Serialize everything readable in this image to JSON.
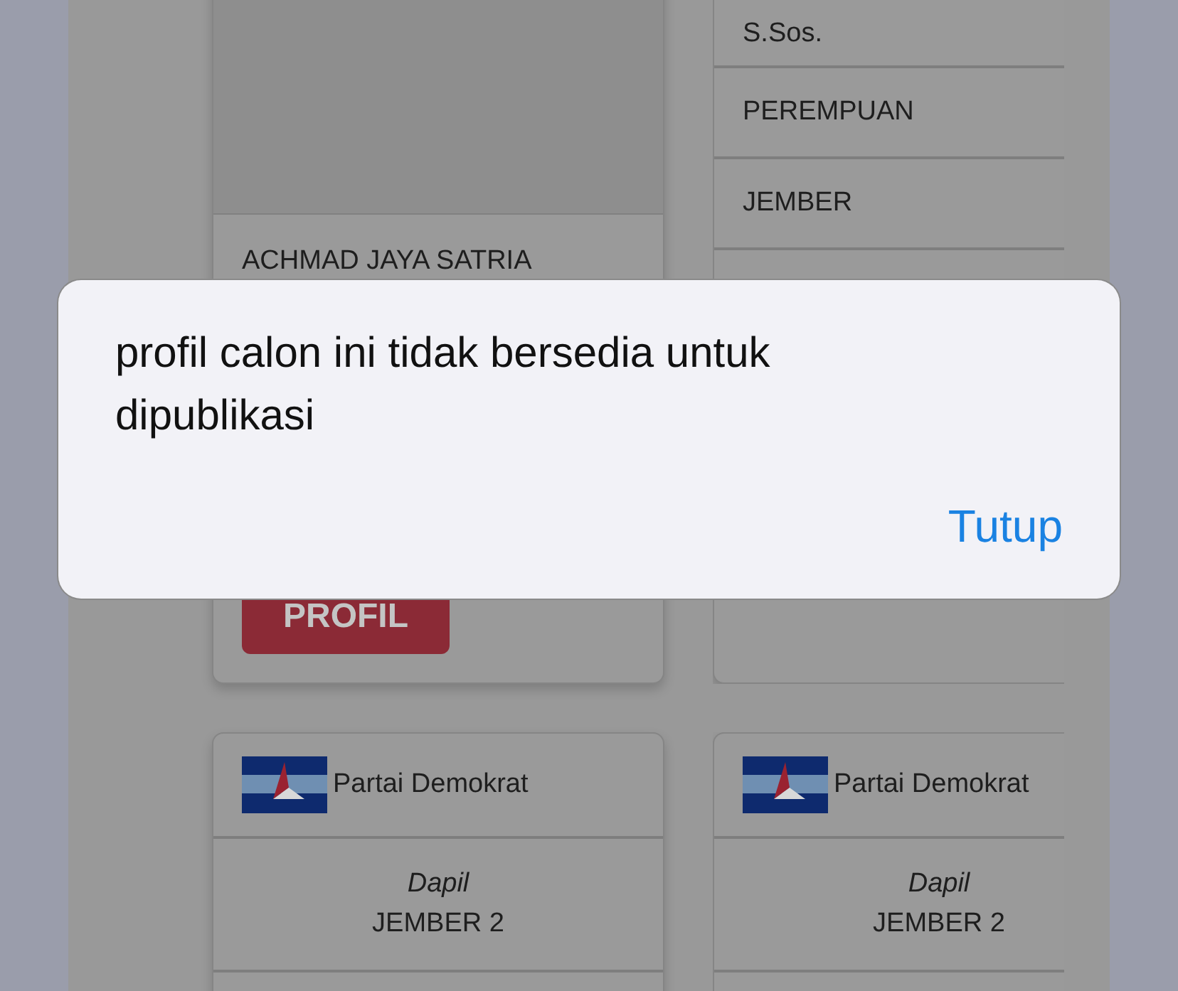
{
  "candidate_card": {
    "name": "ACHMAD JAYA SATRIA",
    "button": "PROFIL"
  },
  "detail_card": {
    "rows": [
      "S.Sos.",
      "PEREMPUAN",
      "JEMBER"
    ]
  },
  "party_cards": [
    {
      "party": "Partai Demokrat",
      "dapil_label": "Dapil",
      "dapil": "JEMBER 2"
    },
    {
      "party": "Partai Demokrat",
      "dapil_label": "Dapil",
      "dapil": "JEMBER 2"
    }
  ],
  "dialog": {
    "message": "profil calon ini tidak bersedia untuk dipublikasi",
    "button": "Tutup"
  }
}
